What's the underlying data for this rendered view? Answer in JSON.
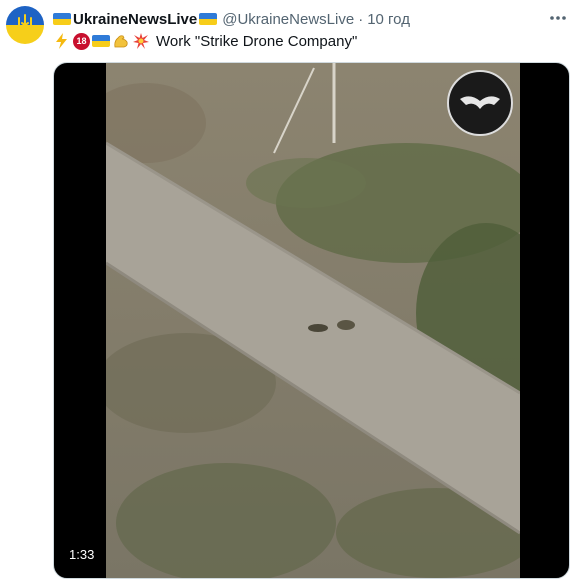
{
  "account": {
    "display_name": "UkraineNewsLive",
    "handle": "@UkraineNewsLive",
    "separator": "·",
    "time": "10 год",
    "avatar_icon": "ukraine-trident-icon"
  },
  "tweet": {
    "text": "Work \"Strike Drone Company\"",
    "emojis": [
      "lightning-icon",
      "no-under-18-icon",
      "ukraine-flag-icon",
      "flexed-bicep-icon",
      "collision-icon"
    ],
    "no_under_18_label": "18"
  },
  "more_icon": "more-horizontal-icon",
  "media": {
    "duration": "1:33",
    "watermark_icon": "strike-drone-company-logo"
  },
  "colors": {
    "ukraine_blue": "#2f7bd8",
    "ukraine_yellow": "#f7cd19",
    "secondary_text": "#536471",
    "badge_red": "#c8102e"
  }
}
